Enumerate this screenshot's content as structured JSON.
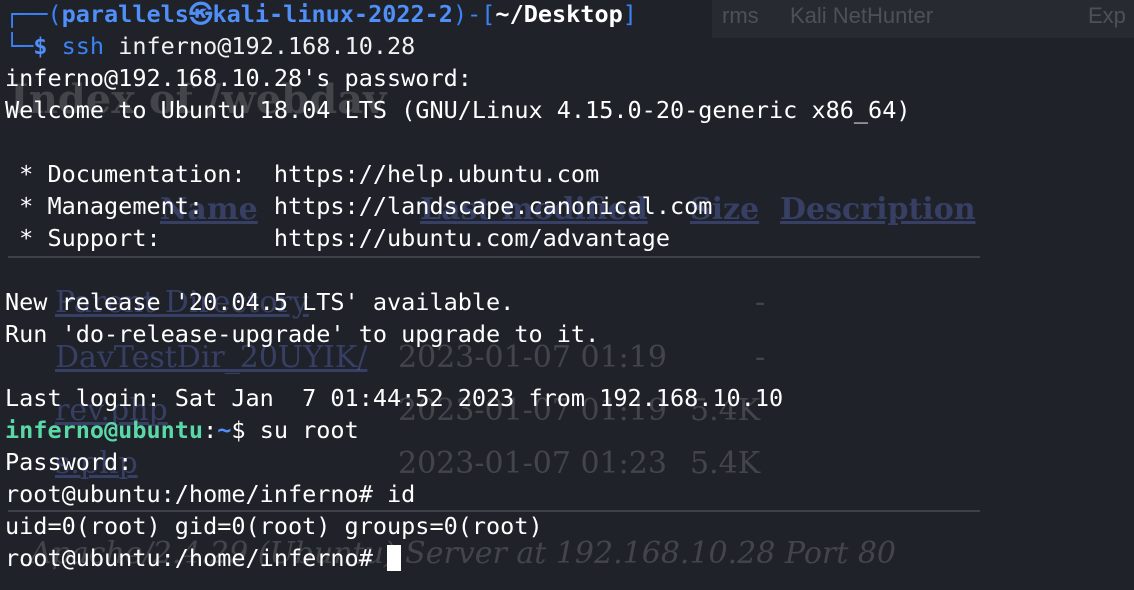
{
  "background": {
    "tabs": [
      "rms",
      "Kali NetHunter",
      "Exp"
    ],
    "heading": "Index of /webdav",
    "columns": [
      "Name",
      "Last modified",
      "Size",
      "Description"
    ],
    "rows": [
      {
        "name": "Parent Directory",
        "modified": "",
        "size": "-"
      },
      {
        "name": "DavTestDir_20UYIK/",
        "modified": "2023-01-07 01:19",
        "size": "-"
      },
      {
        "name": "rev.php",
        "modified": "2023-01-07 01:19",
        "size": "5.4K"
      },
      {
        "name": "s.php",
        "modified": "2023-01-07 01:23",
        "size": "5.4K"
      }
    ],
    "footer": "Apache/2.4.29 (Ubuntu) Server at 192.168.10.28 Port 80"
  },
  "terminal": {
    "prompt_frame_top": "┌──(",
    "prompt_user": "parallels",
    "prompt_symbol": "㉿",
    "prompt_host": "kali-linux-2022-2",
    "prompt_mid": ")-[",
    "prompt_dir": "~/Desktop",
    "prompt_close": "]",
    "prompt_frame_bottom": "└─",
    "prompt_dollar": "$",
    "cmd1_name": "ssh",
    "cmd1_arg": " inferno@192.168.10.28",
    "lines": {
      "password_prompt": "inferno@192.168.10.28's password:",
      "welcome": "Welcome to Ubuntu 18.04 LTS (GNU/Linux 4.15.0-20-generic x86_64)",
      "doc": " * Documentation:  https://help.ubuntu.com",
      "mgmt": " * Management:     https://landscape.canonical.com",
      "support": " * Support:        https://ubuntu.com/advantage",
      "new_release": "New release '20.04.5 LTS' available.",
      "run_upgrade": "Run 'do-release-upgrade' to upgrade to it.",
      "last_login": "Last login: Sat Jan  7 01:44:52 2023 from 192.168.10.10",
      "password2": "Password:",
      "id_output": "uid=0(root) gid=0(root) groups=0(root)"
    },
    "user_prompt_user": "inferno@ubuntu",
    "user_prompt_sep": ":",
    "user_prompt_dir": "~",
    "user_prompt_dollar": "$ ",
    "cmd2": "su root",
    "root_prompt": "root@ubuntu:/home/inferno# ",
    "cmd3": "id"
  }
}
